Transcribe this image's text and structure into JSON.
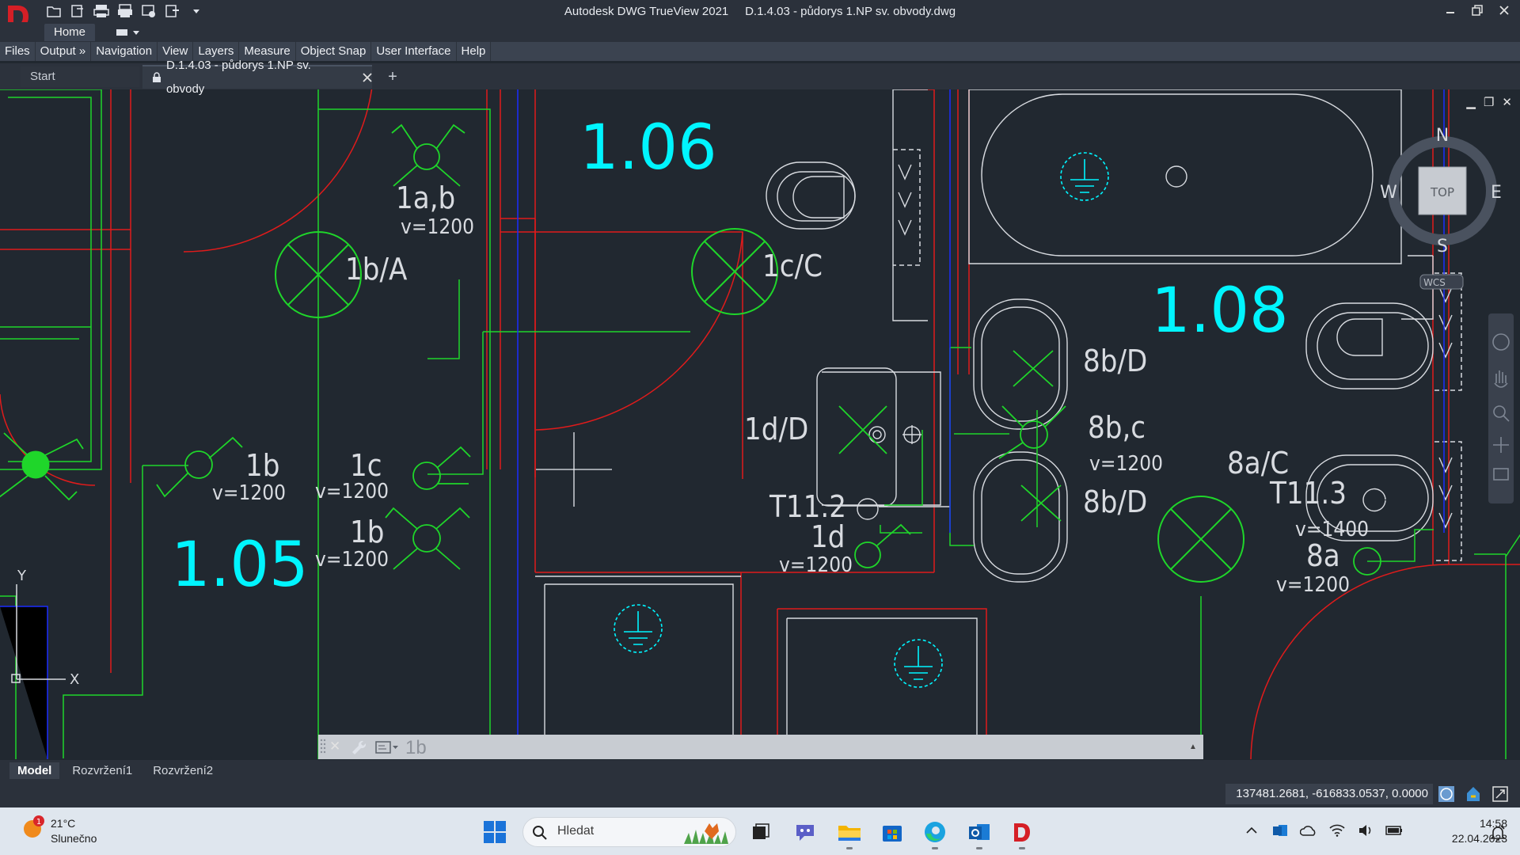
{
  "window": {
    "title": "Autodesk DWG TrueView 2021     D.1.4.03 - půdorys 1.NP sv. obvody.dwg",
    "minimize_icon": "minimize-icon",
    "restore_icon": "restore-icon",
    "close_icon": "close-icon"
  },
  "ribbon": {
    "home_tab": "Home"
  },
  "menu": {
    "items": [
      "Files",
      "Output »",
      "Navigation",
      "View",
      "Layers",
      "Measure",
      "Object Snap",
      "User Interface",
      "Help"
    ]
  },
  "doc_tabs": {
    "start": "Start",
    "active": "D.1.4.03 - půdorys 1.NP sv. obvody",
    "add": "+"
  },
  "drawing": {
    "room_numbers": [
      "1.06",
      "1.05",
      "1.08"
    ],
    "labels": {
      "l_1ab": "1a,b",
      "l_1ab_v": "v=1200",
      "l_1bA": "1b/A",
      "l_1cC": "1c/C",
      "l_1b_left": "1b",
      "l_1b_left_v": "v=1200",
      "l_1c": "1c",
      "l_1c_v": "v=1200",
      "l_1b_mid": "1b",
      "l_1b_mid_v": "v=1200",
      "l_1dD": "1d/D",
      "l_T112": "T11.2",
      "l_1d": "1d",
      "l_1d_v": "v=1200",
      "l_8bD_top": "8b/D",
      "l_8bc": "8b,c",
      "l_8bc_v": "v=1200",
      "l_8bD_bot": "8b/D",
      "l_8aC": "8a/C",
      "l_T113": "T11.3",
      "l_T113_v": "v=1400",
      "l_8a": "8a",
      "l_8a_v": "v=1200"
    },
    "viewcube": {
      "n": "N",
      "s": "S",
      "e": "E",
      "w": "W",
      "top": "TOP",
      "wcs": "WCS"
    },
    "ucs": {
      "y": "Y",
      "x": "X"
    }
  },
  "command_line": {
    "input_text": "1b"
  },
  "layout_tabs": [
    "Model",
    "Rozvržení1",
    "Rozvržení2"
  ],
  "status": {
    "coordinates": "137481.2681, -616833.0537, 0.0000"
  },
  "taskbar": {
    "weather_temp": "21°C",
    "weather_desc": "Slunečno",
    "weather_badge": "1",
    "search_placeholder": "Hledat",
    "time": "14:58",
    "date": "22.04.2023"
  },
  "colors": {
    "background": "#212830",
    "cyan": "#00f5ff",
    "green": "#1fd62a",
    "red": "#e01b1b",
    "white_lines": "#d8dbe0",
    "blue": "#1a2cff"
  }
}
